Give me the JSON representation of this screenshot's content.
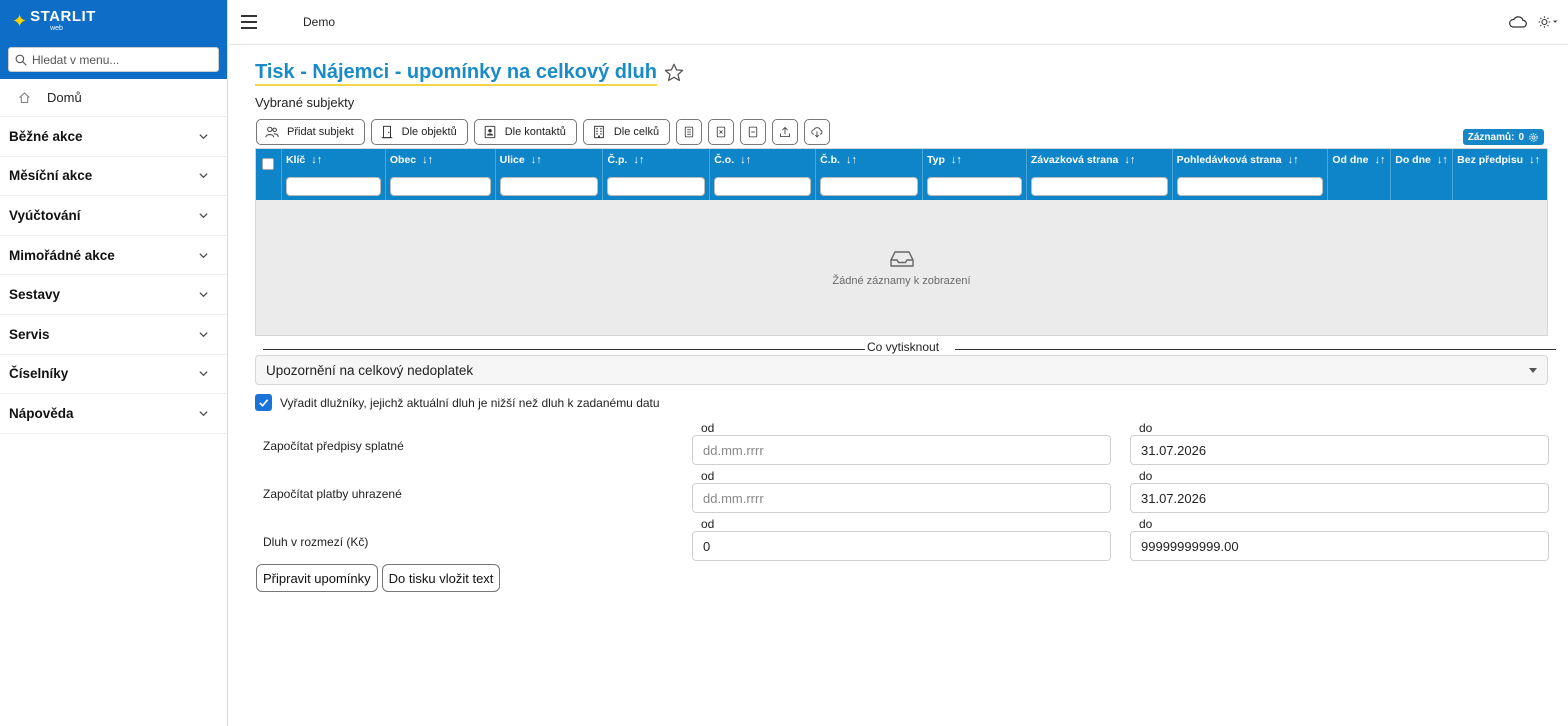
{
  "brand": {
    "name": "STARLIT",
    "sub": "web"
  },
  "sidebar": {
    "search_placeholder": "Hledat v menu...",
    "home_label": "Domů",
    "items": [
      {
        "label": "Běžné akce"
      },
      {
        "label": "Měsíční akce"
      },
      {
        "label": "Vyúčtování"
      },
      {
        "label": "Mimořádné akce"
      },
      {
        "label": "Sestavy"
      },
      {
        "label": "Servis"
      },
      {
        "label": "Číselníky"
      },
      {
        "label": "Nápověda"
      }
    ]
  },
  "topbar": {
    "breadcrumb": "Demo"
  },
  "page": {
    "title": "Tisk - Nájemci - upomínky na celkový dluh",
    "subtitle": "Vybrané subjekty"
  },
  "toolbar": {
    "add_subject": "Přidat subjekt",
    "by_objects": "Dle objektů",
    "by_contacts": "Dle kontaktů",
    "by_units": "Dle celků"
  },
  "records": {
    "label": "Záznamů:",
    "count": "0"
  },
  "grid": {
    "columns": [
      {
        "label": "Klíč"
      },
      {
        "label": "Obec"
      },
      {
        "label": "Ulice"
      },
      {
        "label": "Č.p."
      },
      {
        "label": "Č.o."
      },
      {
        "label": "Č.b."
      },
      {
        "label": "Typ"
      },
      {
        "label": "Závazková strana"
      },
      {
        "label": "Pohledávková strana"
      },
      {
        "label": "Od dne"
      },
      {
        "label": "Do dne"
      },
      {
        "label": "Bez předpisu"
      }
    ],
    "empty_text": "Žádné záznamy k zobrazení"
  },
  "print": {
    "section_label": "Co vytisknout",
    "selected": "Upozornění na celkový nedoplatek",
    "exclude_label": "Vyřadit dlužníky, jejichž aktuální dluh je nižší než dluh k zadanému datu",
    "exclude_checked": true
  },
  "filters": {
    "from_label": "od",
    "to_label": "do",
    "rows": [
      {
        "label": "Započítat předpisy splatné",
        "from_value": "",
        "from_placeholder": "dd.mm.rrrr",
        "to_value": "31.07.2026"
      },
      {
        "label": "Započítat platby uhrazené",
        "from_value": "",
        "from_placeholder": "dd.mm.rrrr",
        "to_value": "31.07.2026"
      },
      {
        "label": "Dluh v rozmezí (Kč)",
        "from_value": "0",
        "from_placeholder": "",
        "to_value": "99999999999.00"
      }
    ]
  },
  "actions": {
    "prepare": "Připravit upomínky",
    "insert_text": "Do tisku vložit text"
  },
  "colors": {
    "brand_blue": "#0e6dc6",
    "grid_header": "#0e85c8",
    "title": "#1a8bc9",
    "title_underline": "#f2d64a",
    "checkbox": "#1a73d8"
  }
}
